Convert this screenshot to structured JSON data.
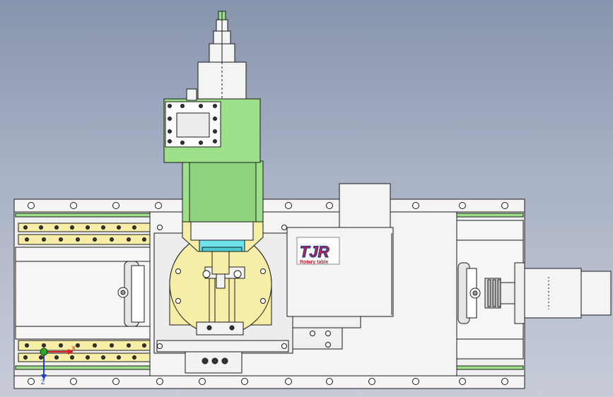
{
  "viewport": {
    "background_top": "#8894ad",
    "background_bottom": "#c7ccd8"
  },
  "model": {
    "colors": {
      "body": "#f2f2f2",
      "edge": "#1a1a1a",
      "green": "#9ee08a",
      "green_dark": "#6cbf5c",
      "yellow": "#f6eea6",
      "cyan": "#6fe3ea",
      "logo_red": "#d91e2a",
      "logo_blue": "#1e3aa8"
    },
    "logo": {
      "text": "TJR",
      "subtext": "Rotary table"
    }
  },
  "triad": {
    "x_label": "X",
    "z_label": "Z",
    "x_color": "#e02020",
    "y_color": "#22b022",
    "z_color": "#2040d0"
  }
}
